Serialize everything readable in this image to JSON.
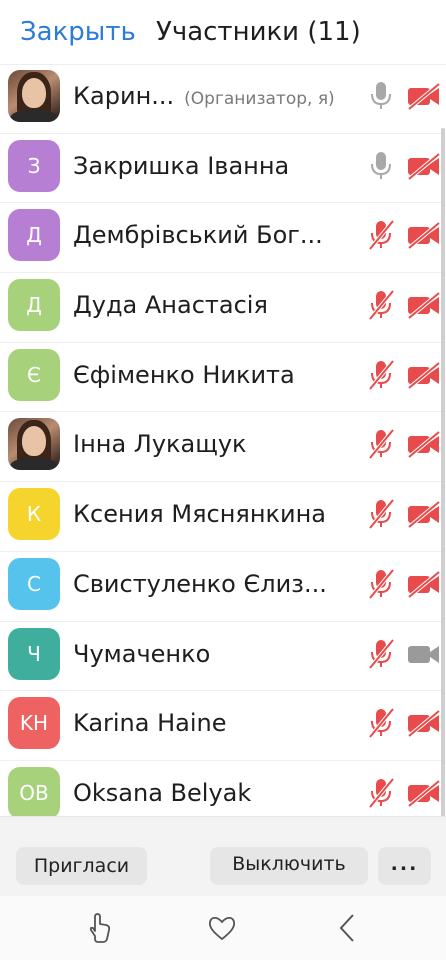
{
  "header": {
    "close_label": "Закрыть",
    "title": "Участники (11)"
  },
  "participants": [
    {
      "name": "Карин...",
      "role": "(Организатор, я)",
      "avatar_type": "photo",
      "mic": "on",
      "camera": "off"
    },
    {
      "name": "Закришка Іванна",
      "initials": "З",
      "color": "#b77fd4",
      "mic": "on",
      "camera": "off"
    },
    {
      "name": "Дембрівський Бог...",
      "initials": "Д",
      "color": "#b77fd4",
      "mic": "muted",
      "camera": "off"
    },
    {
      "name": "Дуда Анастасія",
      "initials": "Д",
      "color": "#a7d17a",
      "mic": "muted",
      "camera": "off"
    },
    {
      "name": "Єфіменко Никита",
      "initials": "Є",
      "color": "#a7d17a",
      "mic": "muted",
      "camera": "off"
    },
    {
      "name": "Інна Лукащук",
      "avatar_type": "photo",
      "mic": "muted",
      "camera": "off"
    },
    {
      "name": "Ксения Мяснянкина",
      "initials": "К",
      "color": "#f5d52d",
      "mic": "muted",
      "camera": "off"
    },
    {
      "name": "Свистуленко Єлиз...",
      "initials": "С",
      "color": "#55c3ec",
      "mic": "muted",
      "camera": "off"
    },
    {
      "name": "Чумаченко",
      "initials": "Ч",
      "color": "#3fae9c",
      "mic": "muted",
      "camera": "on"
    },
    {
      "name": "Karina Haine",
      "initials": "KH",
      "color": "#ef6262",
      "mic": "muted",
      "camera": "off"
    },
    {
      "name": "Oksana Belyak",
      "initials": "OB",
      "color": "#a7d17a",
      "mic": "muted",
      "camera": "off"
    }
  ],
  "bottom_bar": {
    "invite_label": "Пригласи\nть",
    "mute_all_label": "Выключить",
    "more_label": "..."
  },
  "nav": {
    "icons": [
      "touch-icon",
      "heart-icon",
      "back-chevron-icon"
    ]
  },
  "colors": {
    "accent": "#2d7cd6",
    "muted_red": "#e84b4b",
    "icon_gray": "#9a9a9a"
  }
}
